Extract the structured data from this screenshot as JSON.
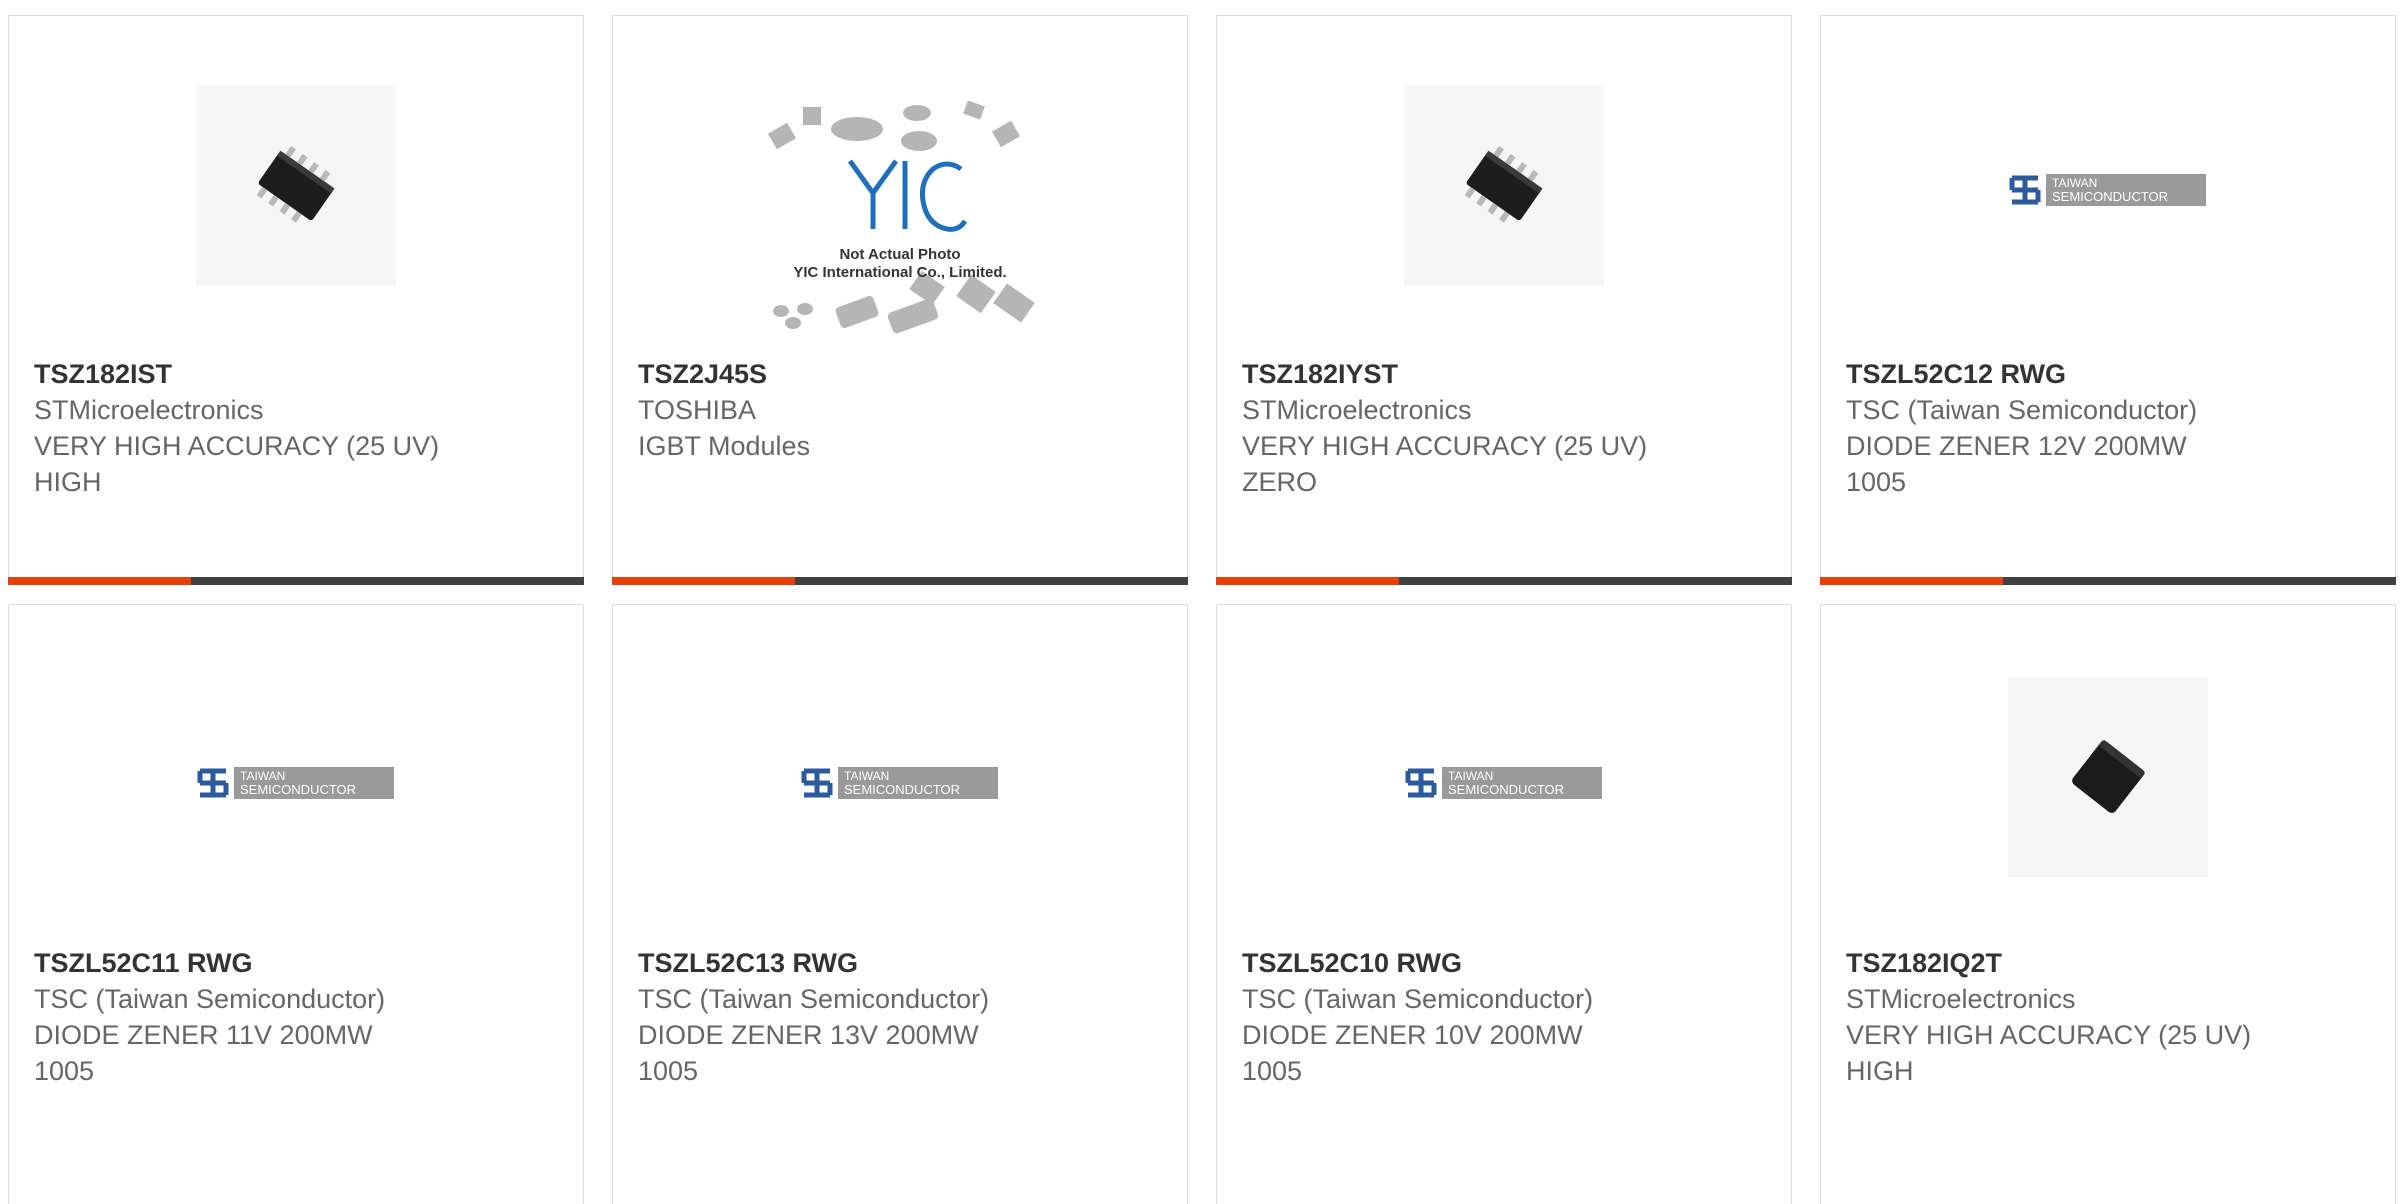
{
  "products": [
    {
      "part": "TSZ182IST",
      "maker": "STMicroelectronics",
      "desc1": "VERY HIGH ACCURACY (25 UV)",
      "desc2": "HIGH",
      "image": "ic-package-photo"
    },
    {
      "part": "TSZ2J45S",
      "maker": "TOSHIBA",
      "desc1": "IGBT Modules",
      "desc2": "",
      "image": "yic-placeholder"
    },
    {
      "part": "TSZ182IYST",
      "maker": "STMicroelectronics",
      "desc1": "VERY HIGH ACCURACY (25 UV)",
      "desc2": "ZERO",
      "image": "ic-package-photo"
    },
    {
      "part": "TSZL52C12 RWG",
      "maker": "TSC (Taiwan Semiconductor)",
      "desc1": "DIODE ZENER 12V 200MW",
      "desc2": "1005",
      "image": "taiwan-semiconductor-logo"
    },
    {
      "part": "TSZL52C11 RWG",
      "maker": "TSC (Taiwan Semiconductor)",
      "desc1": "DIODE ZENER 11V 200MW",
      "desc2": "1005",
      "image": "taiwan-semiconductor-logo"
    },
    {
      "part": "TSZL52C13 RWG",
      "maker": "TSC (Taiwan Semiconductor)",
      "desc1": "DIODE ZENER 13V 200MW",
      "desc2": "1005",
      "image": "taiwan-semiconductor-logo"
    },
    {
      "part": "TSZL52C10 RWG",
      "maker": "TSC (Taiwan Semiconductor)",
      "desc1": "DIODE ZENER 10V 200MW",
      "desc2": "1005",
      "image": "taiwan-semiconductor-logo"
    },
    {
      "part": "TSZ182IQ2T",
      "maker": "STMicroelectronics",
      "desc1": "VERY HIGH ACCURACY (25 UV)",
      "desc2": "HIGH",
      "image": "qfn-package-photo"
    }
  ],
  "yic": {
    "line1": "Not Actual Photo",
    "line2": "YIC International Co., Limited."
  },
  "logo": {
    "line1": "TAIWAN",
    "line2": "SEMICONDUCTOR"
  },
  "colors": {
    "accent": "#e5400b",
    "bar": "#404040",
    "part_text": "#333333",
    "body_text": "#666666",
    "logo_blue": "#2c5a9e",
    "logo_gray": "#9a9a9a"
  }
}
